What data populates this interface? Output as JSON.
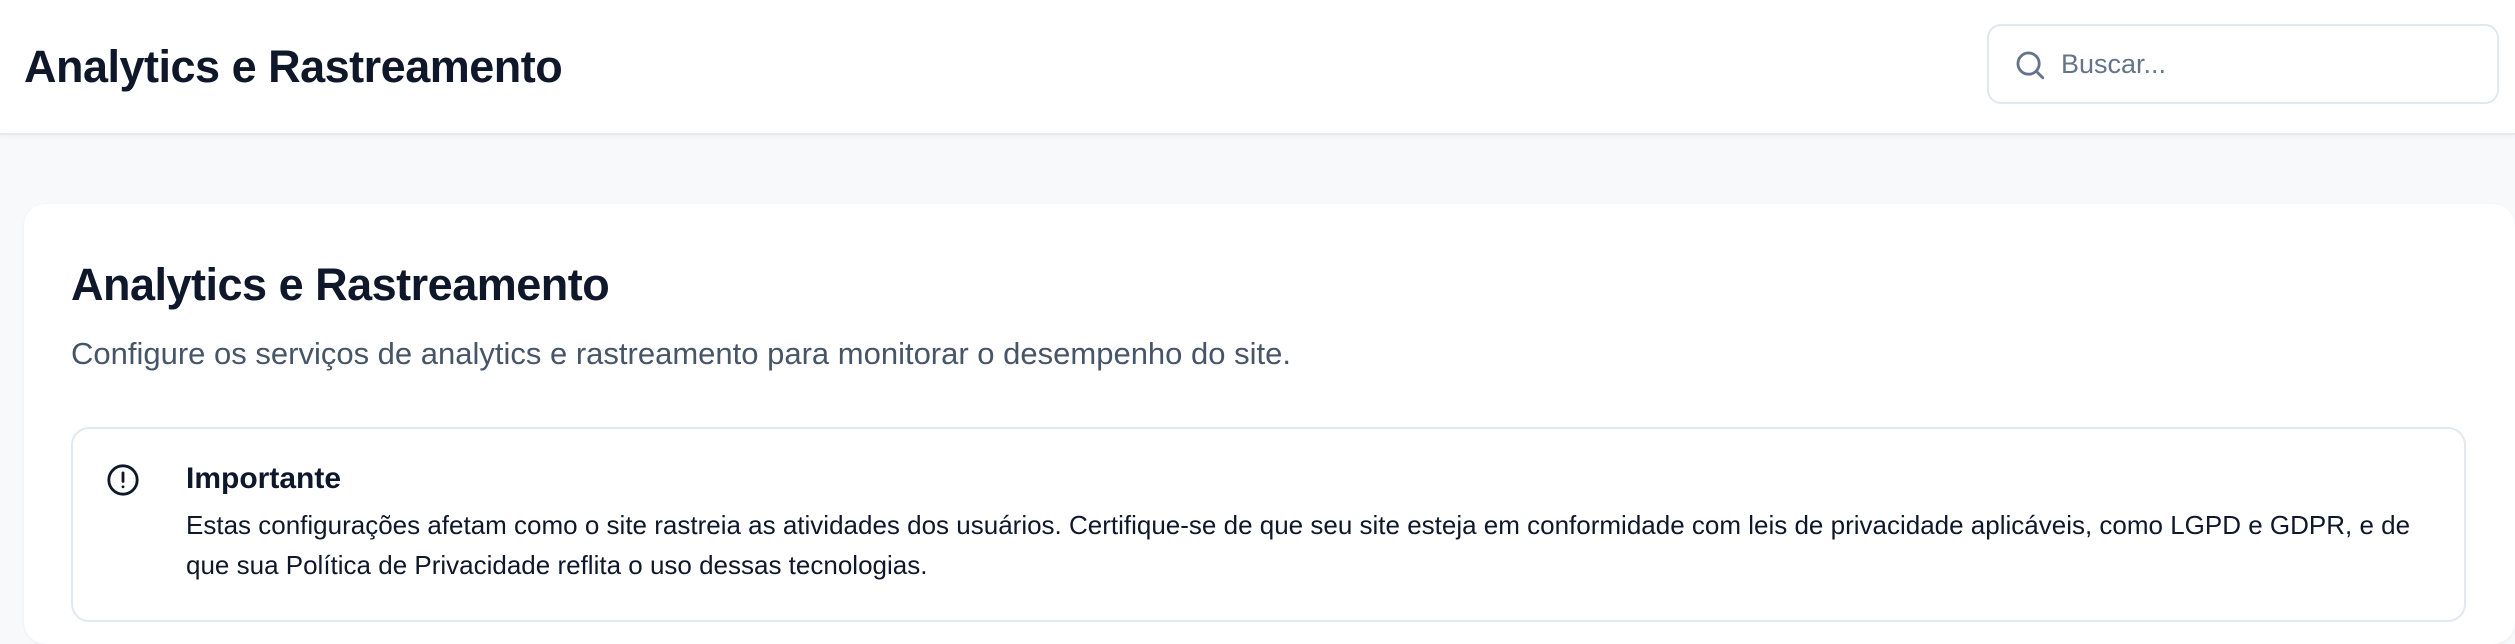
{
  "header": {
    "title": "Analytics e Rastreamento",
    "search": {
      "placeholder": "Buscar...",
      "value": "",
      "icon": "search-icon"
    }
  },
  "main": {
    "title": "Analytics e Rastreamento",
    "description": "Configure os serviços de analytics e rastreamento para monitorar o desempenho do site.",
    "alert": {
      "icon": "alert-circle-icon",
      "title": "Importante",
      "body": "Estas configurações afetam como o site rastreia as atividades dos usuários. Certifique-se de que seu site esteja em conformidade com leis de privacidade aplicáveis, como LGPD e GDPR, e de que sua Política de Privacidade reflita o uso dessas tecnologias."
    }
  },
  "colors": {
    "page_background": "#f8f9fb",
    "surface": "#ffffff",
    "text_primary": "#0f172a",
    "text_secondary": "#475569",
    "border": "#e2e8f0"
  }
}
